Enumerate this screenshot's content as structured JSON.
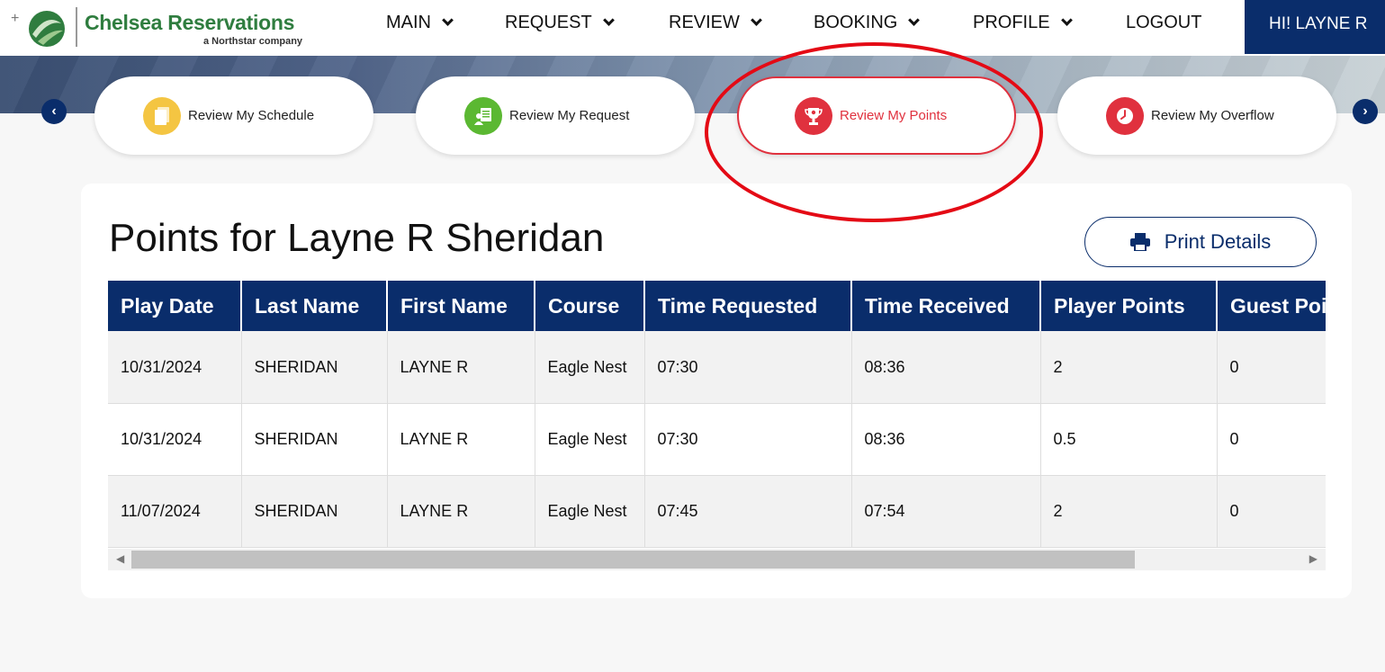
{
  "brand": {
    "name": "Chelsea Reservations",
    "tagline": "a Northstar company"
  },
  "nav": {
    "items": [
      {
        "label": "MAIN",
        "dropdown": true
      },
      {
        "label": "REQUEST",
        "dropdown": true
      },
      {
        "label": "REVIEW",
        "dropdown": true
      },
      {
        "label": "BOOKING",
        "dropdown": true
      },
      {
        "label": "PROFILE",
        "dropdown": true
      },
      {
        "label": "LOGOUT",
        "dropdown": false
      }
    ],
    "user_greeting": "HI! LAYNE R"
  },
  "quick_links": [
    {
      "label": "Review My Schedule",
      "icon": "schedule-icon",
      "color": "#f4c542",
      "active": false
    },
    {
      "label": "Review My Request",
      "icon": "request-icon",
      "color": "#5bb832",
      "active": false
    },
    {
      "label": "Review My Points",
      "icon": "trophy-icon",
      "color": "#e0313e",
      "active": true
    },
    {
      "label": "Review My Overflow",
      "icon": "clock-icon",
      "color": "#e0313e",
      "active": false
    }
  ],
  "page": {
    "title": "Points for Layne R Sheridan",
    "print_label": "Print Details"
  },
  "table": {
    "headers": [
      "Play Date",
      "Last Name",
      "First Name",
      "Course",
      "Time Requested",
      "Time Received",
      "Player Points",
      "Guest Points"
    ],
    "rows": [
      [
        "10/31/2024",
        "SHERIDAN",
        "LAYNE R",
        "Eagle Nest",
        "07:30",
        "08:36",
        "2",
        "0"
      ],
      [
        "10/31/2024",
        "SHERIDAN",
        "LAYNE R",
        "Eagle Nest",
        "07:30",
        "08:36",
        "0.5",
        "0"
      ],
      [
        "11/07/2024",
        "SHERIDAN",
        "LAYNE R",
        "Eagle Nest",
        "07:45",
        "07:54",
        "2",
        "0"
      ]
    ]
  },
  "colors": {
    "navy": "#0a2d6b",
    "accent_red": "#e0313e",
    "brand_green": "#2f7d3f"
  }
}
